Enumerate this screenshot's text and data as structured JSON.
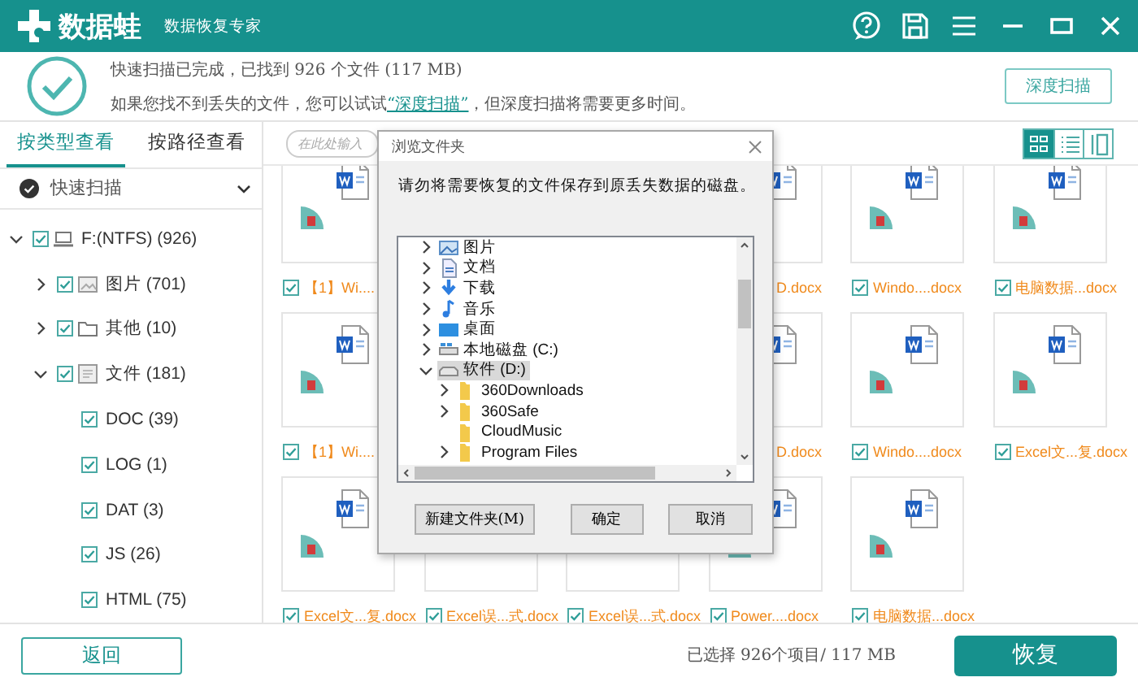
{
  "app": {
    "logo": "数据蛙",
    "subtitle": "数据恢复专家"
  },
  "status": {
    "message": "快速扫描已完成，已找到 926 个文件 (117 MB)",
    "hint_before": "如果您找不到丢失的文件，您可以试试",
    "hint_link": "“深度扫描”",
    "hint_after": "，但深度扫描将需要更多时间。",
    "deep_scan_button": "深度扫描"
  },
  "view_tabs": [
    {
      "label": "按类型查看",
      "selected": true
    },
    {
      "label": "按路径查看",
      "selected": false
    }
  ],
  "scan_mode": "快速扫描",
  "tree": [
    {
      "label": "F:(NTFS) (926)",
      "kind": "drive",
      "checked": true,
      "expanded": true,
      "children": [
        {
          "label": "图片 (701)",
          "kind": "image",
          "checked": true,
          "expanded": false
        },
        {
          "label": "其他 (10)",
          "kind": "folder",
          "checked": true,
          "expanded": false
        },
        {
          "label": "文件 (181)",
          "kind": "document",
          "checked": true,
          "expanded": true,
          "children": [
            {
              "label": "DOC (39)",
              "checked": true
            },
            {
              "label": "LOG (1)",
              "checked": true
            },
            {
              "label": "DAT (3)",
              "checked": true
            },
            {
              "label": "JS (26)",
              "checked": true
            },
            {
              "label": "HTML (75)",
              "checked": true
            }
          ]
        }
      ]
    }
  ],
  "search": {
    "placeholder": "在此处输入"
  },
  "view_modes": [
    {
      "kind": "grid",
      "selected": true
    },
    {
      "kind": "list",
      "selected": false
    },
    {
      "kind": "columns",
      "selected": false
    }
  ],
  "files": [
    {
      "kind": "file",
      "label": "【1】Wi....",
      "checked": true
    },
    {
      "kind": "covered"
    },
    {
      "kind": "covered"
    },
    {
      "kind": "partial",
      "label": "D.docx"
    },
    {
      "kind": "file",
      "label": "Windo....docx",
      "checked": true
    },
    {
      "kind": "file",
      "label": "电脑数据...docx",
      "checked": true
    },
    {
      "kind": "file",
      "label": "【1】Wi....",
      "checked": true
    },
    {
      "kind": "covered"
    },
    {
      "kind": "covered"
    },
    {
      "kind": "partial",
      "label": "D.docx"
    },
    {
      "kind": "file",
      "label": "Windo....docx",
      "checked": true
    },
    {
      "kind": "file",
      "label": "Excel文...复.docx",
      "checked": true
    },
    {
      "kind": "file",
      "label": "Excel文...复.docx",
      "checked": true
    },
    {
      "kind": "file_low",
      "label": "Excel误...式.docx",
      "checked": true
    },
    {
      "kind": "file_low",
      "label": "Excel误...式.docx",
      "checked": true
    },
    {
      "kind": "file",
      "label": "Power....docx",
      "checked": true
    },
    {
      "kind": "file",
      "label": "电脑数据...docx",
      "checked": true
    }
  ],
  "dialog": {
    "title": "浏览文件夹",
    "instruction": "请勿将需要恢复的文件保存到原丢失数据的磁盘。",
    "folders": [
      {
        "label": "图片",
        "kind": "pictures",
        "expanded": false,
        "selected": false
      },
      {
        "label": "文档",
        "kind": "documents",
        "expanded": false,
        "selected": false
      },
      {
        "label": "下载",
        "kind": "downloads",
        "expanded": false,
        "selected": false
      },
      {
        "label": "音乐",
        "kind": "music",
        "expanded": false,
        "selected": false
      },
      {
        "label": "桌面",
        "kind": "desktop",
        "expanded": false,
        "selected": false
      },
      {
        "label": "本地磁盘 (C:)",
        "kind": "system_drive",
        "expanded": false,
        "selected": false
      },
      {
        "label": "软件 (D:)",
        "kind": "drive",
        "expanded": true,
        "selected": true,
        "children": [
          {
            "label": "360Downloads",
            "kind": "folder",
            "expanded": false,
            "selected": false
          },
          {
            "label": "360Safe",
            "kind": "folder",
            "expanded": false,
            "selected": false
          },
          {
            "label": "CloudMusic",
            "kind": "folder",
            "selected": false
          },
          {
            "label": "Program Files",
            "kind": "folder",
            "expanded": false,
            "selected": false
          }
        ]
      }
    ],
    "buttons": [
      "新建文件夹(M)",
      "确定",
      "取消"
    ]
  },
  "selection_summary": "已选择 926个项目/ 117 MB",
  "back_button": "返回",
  "recover_button": "恢复"
}
